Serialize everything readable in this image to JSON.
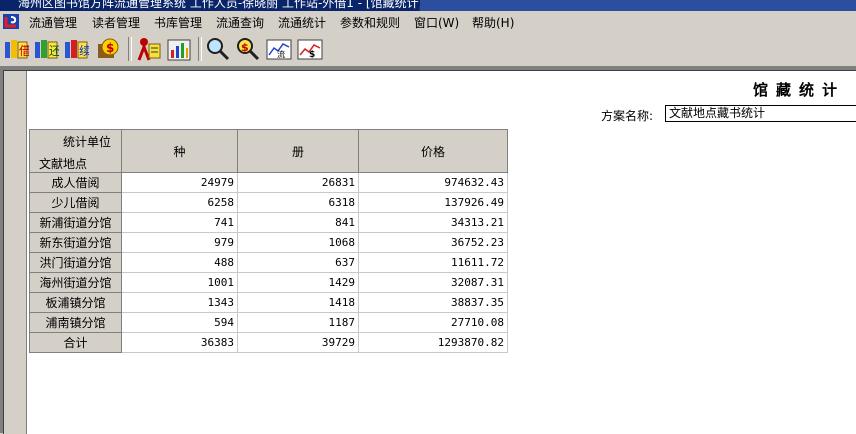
{
  "window": {
    "title": "海州区图书馆方阵流通管理系统 工作人员-徐晓丽 工作站-外借1 - [馆藏统计]"
  },
  "menu": {
    "items": [
      "流通管理",
      "读者管理",
      "书库管理",
      "流通查询",
      "流通统计",
      "参数和规则",
      "窗口(W)",
      "帮助(H)"
    ]
  },
  "toolbar": {
    "icons": [
      "borrow-icon",
      "return-icon",
      "renew-icon",
      "fine-icon",
      "reader-icon",
      "stats-icon",
      "search-icon",
      "money-search-icon",
      "circulation-chart-icon",
      "amount-chart-icon"
    ]
  },
  "report": {
    "heading": "馆藏统计",
    "scheme_label": "方案名称:",
    "scheme_value": "文献地点藏书统计",
    "corner_top": "统计单位",
    "corner_bottom": "文献地点",
    "columns": [
      "种",
      "册",
      "价格"
    ],
    "rows": [
      {
        "name": "成人借阅",
        "kinds": "24979",
        "copies": "26831",
        "price": "974632.43"
      },
      {
        "name": "少儿借阅",
        "kinds": "6258",
        "copies": "6318",
        "price": "137926.49"
      },
      {
        "name": "新浦街道分馆",
        "kinds": "741",
        "copies": "841",
        "price": "34313.21"
      },
      {
        "name": "新东街道分馆",
        "kinds": "979",
        "copies": "1068",
        "price": "36752.23"
      },
      {
        "name": "洪门街道分馆",
        "kinds": "488",
        "copies": "637",
        "price": "11611.72"
      },
      {
        "name": "海州街道分馆",
        "kinds": "1001",
        "copies": "1429",
        "price": "32087.31"
      },
      {
        "name": "板浦镇分馆",
        "kinds": "1343",
        "copies": "1418",
        "price": "38837.35"
      },
      {
        "name": "浦南镇分馆",
        "kinds": "594",
        "copies": "1187",
        "price": "27710.08"
      },
      {
        "name": "合计",
        "kinds": "36383",
        "copies": "39729",
        "price": "1293870.82"
      }
    ]
  }
}
